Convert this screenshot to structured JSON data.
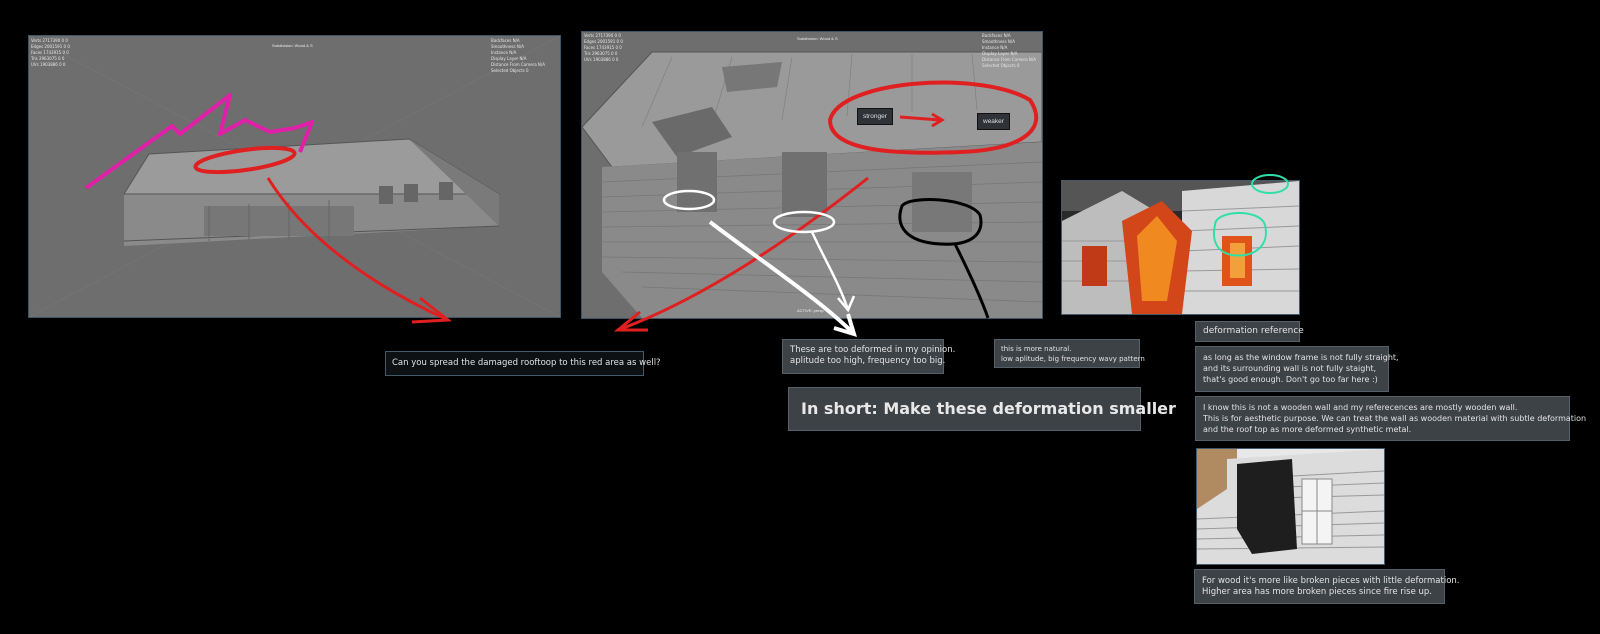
{
  "viewport1": {
    "title": "Subdivision: Wood & S",
    "stats_left": [
      "Verts 2717390 0 0",
      "Edges 2001591 0 0",
      "Faces 1743915 0 0",
      "Tris 2963075 0 0",
      "UVs 1903886 0 0"
    ],
    "stats_right": [
      "Backfaces N/A",
      "Smoothness N/A",
      "Instance N/A",
      "Display Layer N/A",
      "Distance From Camera N/A",
      "Selected Objects 0"
    ]
  },
  "viewport2": {
    "title": "Subdivision: Wood & S",
    "stats_left": [
      "Verts 2717390 0 0",
      "Edges 2001591 0 0",
      "Faces 1743915 0 0",
      "Tris 2963075 0 0",
      "UVs 1903886 0 0"
    ],
    "stats_right": [
      "Backfaces N/A",
      "Smoothness N/A",
      "Instance N/A",
      "Display Layer N/A",
      "Distance From Camera N/A",
      "Selected Objects 0"
    ],
    "tag_stronger": "stronger",
    "tag_weaker": "weaker",
    "footer": "ACTIVE: persp"
  },
  "notes": {
    "spread": "Can you spread the damaged rooftoop to this red area as well?",
    "too_deformed": [
      "These are too deformed in my opinion.",
      "aplitude too high, frequency too big."
    ],
    "more_natural": [
      "this is more natural.",
      "low aplitude, big frequency wavy pattern"
    ],
    "in_short": "In short: Make these deformation smaller",
    "deformation_reference": "deformation reference",
    "window_frame": [
      "as long as the window frame is not fully straight,",
      "and its surrounding wall is not fully staight,",
      "that's good enough. Don't go too far here :)"
    ],
    "wooden_wall": [
      "I know this is not a wooden wall and my referecences are mostly wooden wall.",
      "This is for aesthetic purpose. We can treat the wall as wooden material with subtle deformation",
      "and the roof top as more deformed synthetic metal."
    ],
    "broken_pieces": [
      "For wood it's more like broken pieces with little deformation.",
      "Higher area has more broken pieces since fire rise up."
    ]
  },
  "colors": {
    "red_annotation": "#e02020",
    "magenta_annotation": "#e020a8",
    "teal_annotation": "#2ee0a8",
    "white_annotation": "#ffffff",
    "note_bg": "#3d4247"
  }
}
